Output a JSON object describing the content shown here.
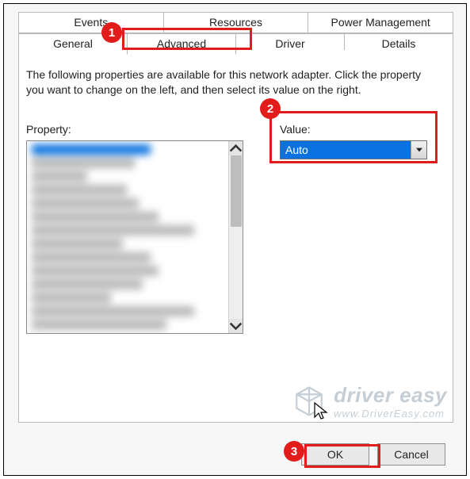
{
  "tabs": {
    "row1": [
      "Events",
      "Resources",
      "Power Management"
    ],
    "row2": [
      "General",
      "Advanced",
      "Driver",
      "Details"
    ],
    "selected": "Advanced"
  },
  "description": "The following properties are available for this network adapter. Click the property you want to change on the left, and then select its value on the right.",
  "labels": {
    "property": "Property:",
    "value": "Value:"
  },
  "value_combo": {
    "selected": "Auto"
  },
  "buttons": {
    "ok": "OK",
    "cancel": "Cancel"
  },
  "annotations": {
    "badge1": "1",
    "badge2": "2",
    "badge3": "3"
  },
  "watermark": {
    "name": "driver easy",
    "url": "www.DriverEasy.com"
  }
}
